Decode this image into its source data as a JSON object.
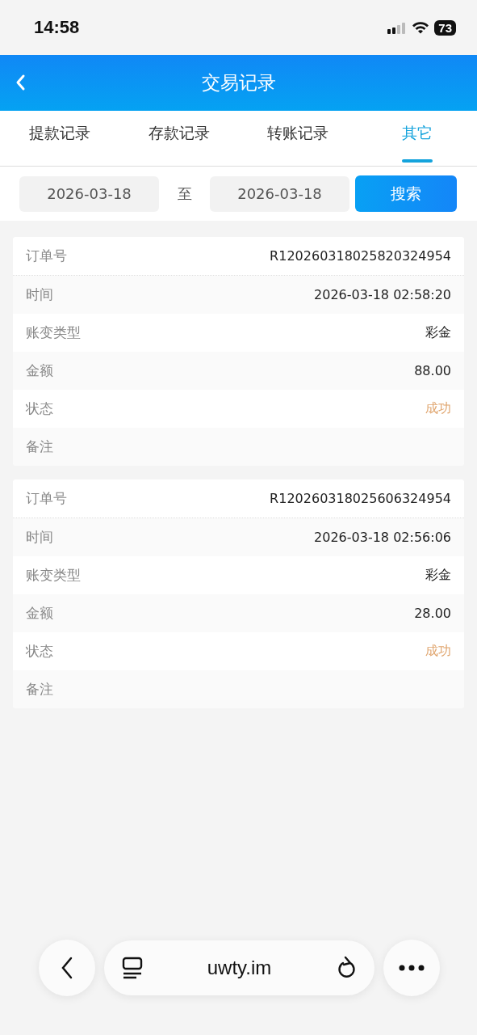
{
  "status_bar": {
    "time": "14:58",
    "battery": "73"
  },
  "header": {
    "title": "交易记录"
  },
  "tabs": [
    {
      "label": "提款记录",
      "selected": false
    },
    {
      "label": "存款记录",
      "selected": false
    },
    {
      "label": "转账记录",
      "selected": false
    },
    {
      "label": "其它",
      "selected": true
    }
  ],
  "filter": {
    "start_date": "2026-03-18",
    "separator": "至",
    "end_date": "2026-03-18",
    "search_button": "搜索"
  },
  "records": [
    {
      "rows": [
        {
          "label": "订单号",
          "value": "R120260318025820324954",
          "kind": "text"
        },
        {
          "label": "时间",
          "value": "2026-03-18 02:58:20",
          "kind": "text"
        },
        {
          "label": "账变类型",
          "value": "彩金",
          "kind": "text"
        },
        {
          "label": "金额",
          "value": "88.00",
          "kind": "text"
        },
        {
          "label": "状态",
          "value": "成功",
          "kind": "status"
        },
        {
          "label": "备注"
        }
      ]
    },
    {
      "rows": [
        {
          "label": "订单号",
          "value": "R120260318025606324954",
          "kind": "text"
        },
        {
          "label": "时间",
          "value": "2026-03-18 02:56:06",
          "kind": "text"
        },
        {
          "label": "账变类型",
          "value": "彩金",
          "kind": "text"
        },
        {
          "label": "金额",
          "value": "28.00",
          "kind": "text"
        },
        {
          "label": "状态",
          "value": "成功",
          "kind": "status"
        },
        {
          "label": "备注"
        }
      ]
    }
  ],
  "browser_bar": {
    "url": "uwty.im"
  }
}
